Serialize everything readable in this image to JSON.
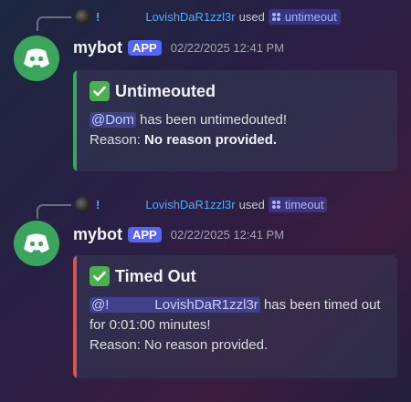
{
  "colors": {
    "success_bar": "#3ba55d",
    "error_bar": "#d9534f",
    "avatar_bg": "#3ba55d",
    "app_badge": "#5865f2",
    "link_blue": "#5aa8f0",
    "checkmark": "#4caf50"
  },
  "messages": [
    {
      "reply": {
        "name_suffix": "!",
        "user": "LovishDaR1zzl3r",
        "used": "used",
        "command": "untimeout"
      },
      "bot": {
        "name": "mybot",
        "badge": "APP",
        "timestamp": "02/22/2025 12:41 PM",
        "avatar_icon": "discord-logo-icon"
      },
      "embed": {
        "icon": "check-mark-icon",
        "title": "Untimeouted",
        "mention": "@Dom",
        "line1_rest": " has been untimedouted!",
        "reason_label": "Reason: ",
        "reason_value": "No reason provided."
      }
    },
    {
      "reply": {
        "name_suffix": "!",
        "user": "LovishDaR1zzl3r",
        "used": "used",
        "command": "timeout"
      },
      "bot": {
        "name": "mybot",
        "badge": "APP",
        "timestamp": "02/22/2025 12:41 PM",
        "avatar_icon": "discord-logo-icon"
      },
      "embed": {
        "icon": "check-mark-icon",
        "title": "Timed Out",
        "mention": "@!            LovishDaR1zzl3r",
        "line1_rest": " has been timed out for 0:01:00 minutes!",
        "reason_line": "Reason: No reason provided."
      }
    }
  ]
}
